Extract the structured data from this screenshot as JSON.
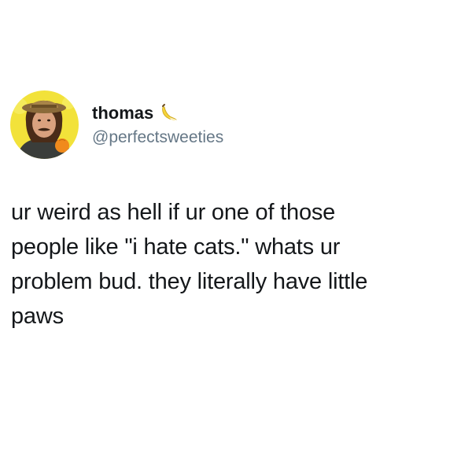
{
  "tweet": {
    "author": {
      "display_name": "thomas",
      "name_emoji": "banana-icon",
      "handle": "@perfectsweeties"
    },
    "text": "ur weird as hell if ur one of those\npeople like \"i hate cats.\" whats ur\nproblem bud. they literally have little\npaws"
  },
  "colors": {
    "background": "#ffffff",
    "text": "#14171a",
    "handle": "#657786",
    "avatar_background": "#f2e23a"
  }
}
